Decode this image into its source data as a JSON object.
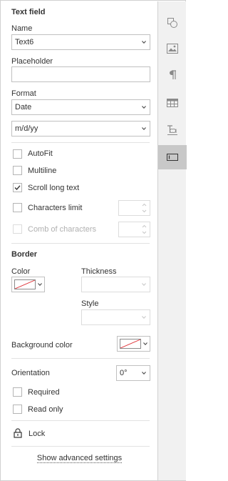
{
  "title": "Text field",
  "name": {
    "label": "Name",
    "value": "Text6"
  },
  "placeholder": {
    "label": "Placeholder",
    "value": ""
  },
  "format": {
    "label": "Format",
    "value": "Date",
    "pattern": "m/d/yy"
  },
  "checkboxes": {
    "autofit": {
      "label": "AutoFit",
      "checked": false
    },
    "multiline": {
      "label": "Multiline",
      "checked": false
    },
    "scroll": {
      "label": "Scroll long text",
      "checked": true
    },
    "char_limit": {
      "label": "Characters limit",
      "checked": false
    },
    "comb": {
      "label": "Comb of characters",
      "checked": false,
      "disabled": true
    }
  },
  "border": {
    "heading": "Border",
    "color_label": "Color",
    "thickness_label": "Thickness",
    "style_label": "Style",
    "color": "none"
  },
  "background": {
    "label": "Background color",
    "color": "none"
  },
  "orientation": {
    "label": "Orientation",
    "value": "0°"
  },
  "required": {
    "label": "Required",
    "checked": false
  },
  "readonly": {
    "label": "Read only",
    "checked": false
  },
  "lock": {
    "label": "Lock"
  },
  "advanced": {
    "label": "Show advanced settings"
  },
  "sidebar": {
    "items": [
      {
        "icon": "shape-icon"
      },
      {
        "icon": "image-icon"
      },
      {
        "icon": "paragraph-icon"
      },
      {
        "icon": "table-icon"
      },
      {
        "icon": "text-art-icon"
      },
      {
        "icon": "form-field-icon",
        "active": true
      }
    ]
  },
  "colors": {
    "border": "#c0c0c0",
    "active_tab": "#c8c8c8",
    "sidebar_bg": "#f1f1f1",
    "no_color_line": "#e0393e"
  }
}
